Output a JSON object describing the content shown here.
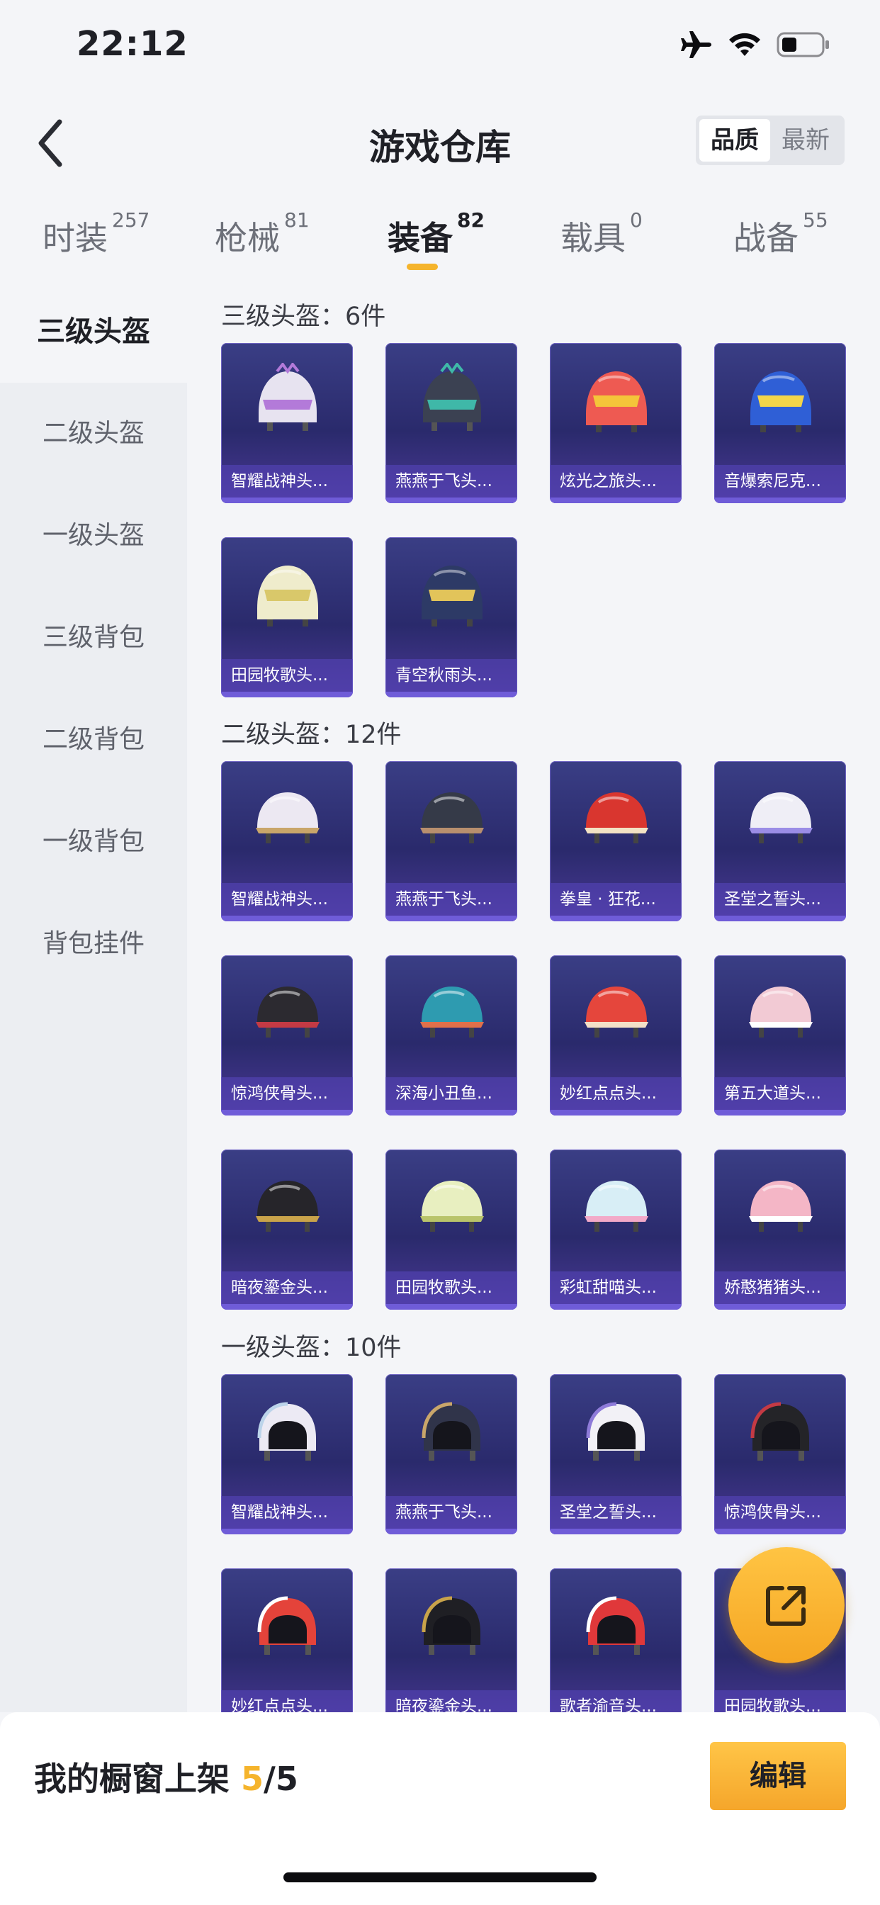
{
  "status_bar": {
    "time": "22:12",
    "icons": [
      "airplane-icon",
      "wifi-icon",
      "battery-icon"
    ]
  },
  "nav": {
    "back_icon": "chevron-left-icon",
    "title": "游戏仓库",
    "sort_options": [
      {
        "label": "品质",
        "active": true
      },
      {
        "label": "最新",
        "active": false
      }
    ]
  },
  "tabs": [
    {
      "label": "时装",
      "count": "257",
      "active": false
    },
    {
      "label": "枪械",
      "count": "81",
      "active": false
    },
    {
      "label": "装备",
      "count": "82",
      "active": true
    },
    {
      "label": "载具",
      "count": "0",
      "active": false
    },
    {
      "label": "战备",
      "count": "55",
      "active": false
    }
  ],
  "sidebar": {
    "items": [
      {
        "label": "三级头盔",
        "active": true
      },
      {
        "label": "二级头盔",
        "active": false
      },
      {
        "label": "一级头盔",
        "active": false
      },
      {
        "label": "三级背包",
        "active": false
      },
      {
        "label": "二级背包",
        "active": false
      },
      {
        "label": "一级背包",
        "active": false
      },
      {
        "label": "背包挂件",
        "active": false
      }
    ]
  },
  "sections": [
    {
      "title": "三级头盔：6件",
      "items": [
        {
          "name": "智耀战神头...",
          "color": "#e7e3f0",
          "accent": "#b37ad9",
          "shape": "crown"
        },
        {
          "name": "燕燕于飞头...",
          "color": "#3b4152",
          "accent": "#3fb8a8",
          "shape": "crown"
        },
        {
          "name": "炫光之旅头...",
          "color": "#ee5a52",
          "accent": "#f4c53a",
          "shape": "full"
        },
        {
          "name": "音爆索尼克...",
          "color": "#2f5fd6",
          "accent": "#f2d54a",
          "shape": "full"
        },
        {
          "name": "田园牧歌头...",
          "color": "#efeccc",
          "accent": "#d9c86a",
          "shape": "full"
        },
        {
          "name": "青空秋雨头...",
          "color": "#2d3a66",
          "accent": "#e2c45a",
          "shape": "full"
        }
      ]
    },
    {
      "title": "二级头盔：12件",
      "items": [
        {
          "name": "智耀战神头...",
          "color": "#ece8f2",
          "accent": "#c9a66a",
          "shape": "half"
        },
        {
          "name": "燕燕于飞头...",
          "color": "#353a48",
          "accent": "#b88f6e",
          "shape": "half"
        },
        {
          "name": "拳皇 · 狂花...",
          "color": "#d9362f",
          "accent": "#f2e2c4",
          "shape": "half"
        },
        {
          "name": "圣堂之誓头...",
          "color": "#efeef6",
          "accent": "#9b8de6",
          "shape": "half"
        },
        {
          "name": "惊鸿侠骨头...",
          "color": "#2c2a30",
          "accent": "#c43a44",
          "shape": "half"
        },
        {
          "name": "深海小丑鱼...",
          "color": "#2e9bb0",
          "accent": "#e0704a",
          "shape": "half"
        },
        {
          "name": "妙红点点头...",
          "color": "#e5463c",
          "accent": "#f3e0c8",
          "shape": "half"
        },
        {
          "name": "第五大道头...",
          "color": "#f2cad4",
          "accent": "#ffffff",
          "shape": "half"
        },
        {
          "name": "暗夜鎏金头...",
          "color": "#26252a",
          "accent": "#c9a34a",
          "shape": "half"
        },
        {
          "name": "田园牧歌头...",
          "color": "#e8efc0",
          "accent": "#b9c46a",
          "shape": "half"
        },
        {
          "name": "彩虹甜喵头...",
          "color": "#d8eef6",
          "accent": "#f2a9c8",
          "shape": "half"
        },
        {
          "name": "娇憨猪猪头...",
          "color": "#f4b6c6",
          "accent": "#ffffff",
          "shape": "half"
        }
      ]
    },
    {
      "title": "一级头盔：10件",
      "items": [
        {
          "name": "智耀战神头...",
          "color": "#eceaf4",
          "accent": "#bcd4ea",
          "shape": "open"
        },
        {
          "name": "燕燕于飞头...",
          "color": "#30344a",
          "accent": "#c9a66a",
          "shape": "open"
        },
        {
          "name": "圣堂之誓头...",
          "color": "#f2f1f6",
          "accent": "#8e7bd9",
          "shape": "open"
        },
        {
          "name": "惊鸿侠骨头...",
          "color": "#242428",
          "accent": "#c43a44",
          "shape": "open"
        },
        {
          "name": "妙红点点头...",
          "color": "#e4433a",
          "accent": "#ffffff",
          "shape": "open"
        },
        {
          "name": "暗夜鎏金头...",
          "color": "#1f1f24",
          "accent": "#c9a34a",
          "shape": "open"
        },
        {
          "name": "歌者渝音头...",
          "color": "#e0383a",
          "accent": "#ffffff",
          "shape": "open"
        },
        {
          "name": "田园牧歌头...",
          "color": "#e8efc0",
          "accent": "#d9c86a",
          "shape": "open"
        }
      ]
    }
  ],
  "fab": {
    "icon": "share-icon"
  },
  "bottom": {
    "shelf_label": "我的橱窗上架",
    "shelf_current": "5",
    "shelf_total": "/5",
    "edit_label": "编辑"
  }
}
